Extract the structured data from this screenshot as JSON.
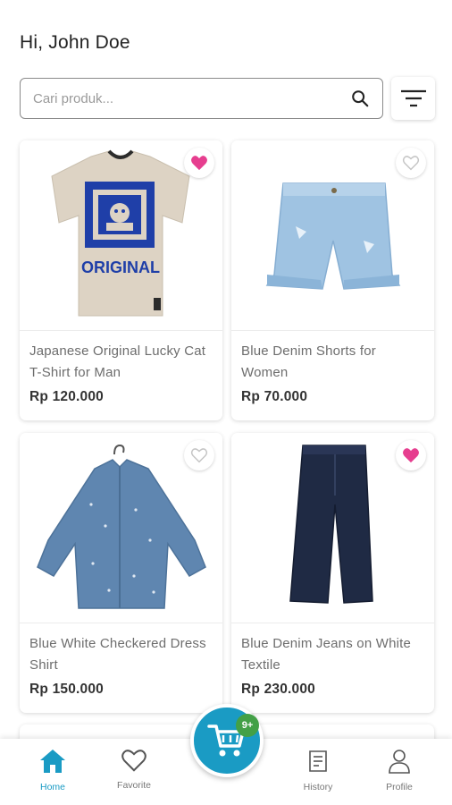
{
  "header": {
    "greeting": "Hi, John Doe"
  },
  "search": {
    "placeholder": "Cari produk...",
    "value": ""
  },
  "filter": {
    "icon": "filter-lines-icon"
  },
  "products": [
    {
      "name": "Japanese Original Lucky Cat T-Shirt for Man",
      "price": "Rp 120.000",
      "favorited": true
    },
    {
      "name": "Blue Denim Shorts for Women",
      "price": "Rp 70.000",
      "favorited": false
    },
    {
      "name": "Blue White Checkered Dress Shirt",
      "price": "Rp 150.000",
      "favorited": false
    },
    {
      "name": "Blue Denim Jeans on White Textile",
      "price": "Rp 230.000",
      "favorited": true
    }
  ],
  "bottom_nav": {
    "items": [
      {
        "label": "Home",
        "icon": "home-icon",
        "active": true
      },
      {
        "label": "Favorite",
        "icon": "heart-icon",
        "active": false
      },
      {
        "label": "History",
        "icon": "receipt-icon",
        "active": false
      },
      {
        "label": "Profile",
        "icon": "person-icon",
        "active": false
      }
    ],
    "cart": {
      "icon": "cart-icon",
      "badge": "9+"
    }
  },
  "colors": {
    "accent": "#1a9bc4",
    "favorite": "#e63e8f",
    "badge": "#43a047"
  }
}
